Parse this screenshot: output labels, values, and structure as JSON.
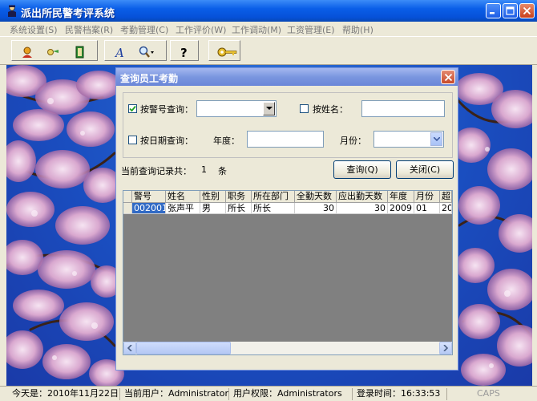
{
  "window": {
    "title": "派出所民警考评系统"
  },
  "menu": [
    "系统设置(S)",
    "民警档案(R)",
    "考勤管理(C)",
    "工作评价(W)",
    "工作调动(M)",
    "工资管理(E)",
    "帮助(H)"
  ],
  "toolbar": {
    "icons": [
      "user-icon",
      "key-pair-icon",
      "exit-door-icon",
      "font-icon",
      "search-icon",
      "help-question-icon",
      "key-icon"
    ]
  },
  "dialog": {
    "title": "查询员工考勤",
    "by_id_label": "按警号查询：",
    "by_id_checked": true,
    "by_id_value": "",
    "by_name_label": "按姓名：",
    "by_name_value": "",
    "by_date_label": "按日期查询：",
    "year_label": "年度：",
    "year_value": "",
    "month_label": "月份：",
    "month_value": "",
    "record_count_label": "当前查询记录共：",
    "record_count": "1",
    "record_unit": "条",
    "query_button": "查询(Q)",
    "close_button": "关闭(C)"
  },
  "table": {
    "columns": [
      "警号",
      "姓名",
      "性别",
      "职务",
      "所在部门",
      "全勤天数",
      "应出勤天数",
      "年度",
      "月份",
      "超"
    ],
    "rows": [
      [
        "002001",
        "张声平",
        "男",
        "所长",
        "所长",
        "30",
        "30",
        "2009",
        "01",
        "20"
      ]
    ]
  },
  "status": {
    "date_label": "今天是：",
    "date_value": "2010年11月22日",
    "user_label": "当前用户：",
    "user_value": "Administrator",
    "perm_label": "用户权限：",
    "perm_value": "Administrators",
    "login_label": "登录时间：",
    "login_value": "16:33:53",
    "caps": "CAPS"
  },
  "colors": {
    "titlebar": "#0a5ee8",
    "dialog_title": "#7a96df",
    "selection": "#316ac5",
    "face": "#ece9d8"
  }
}
